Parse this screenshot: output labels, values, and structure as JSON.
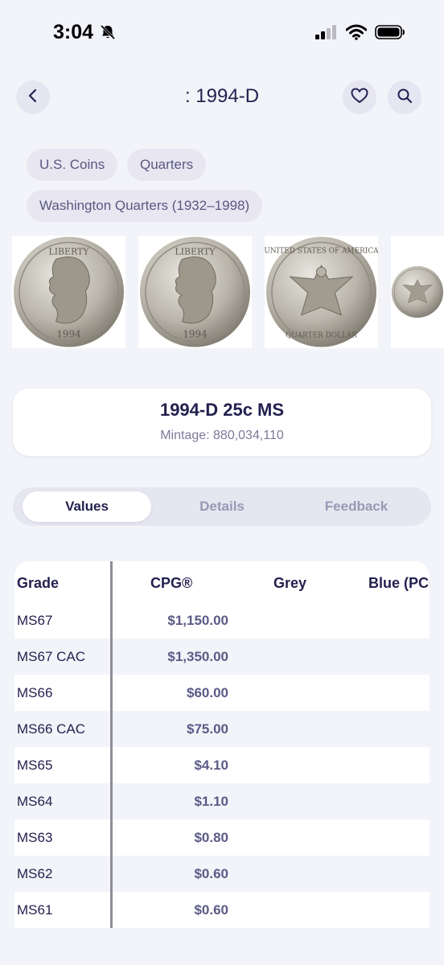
{
  "status_bar": {
    "time": "3:04"
  },
  "header": {
    "title": ": 1994-D"
  },
  "breadcrumbs": [
    "U.S. Coins",
    "Quarters",
    "Washington Quarters (1932–1998)"
  ],
  "coin_images": [
    "obverse",
    "obverse",
    "reverse",
    "reverse"
  ],
  "coin": {
    "name": "1994-D 25c MS",
    "mintage_label": "Mintage:",
    "mintage_value": "880,034,110"
  },
  "tabs": [
    {
      "label": "Values",
      "active": true
    },
    {
      "label": "Details",
      "active": false
    },
    {
      "label": "Feedback",
      "active": false
    }
  ],
  "table": {
    "headers": [
      "Grade",
      "CPG®",
      "Grey",
      "Blue (PCG"
    ],
    "rows": [
      {
        "grade": "MS67",
        "cpg": "$1,150.00"
      },
      {
        "grade": "MS67 CAC",
        "cpg": "$1,350.00"
      },
      {
        "grade": "MS66",
        "cpg": "$60.00"
      },
      {
        "grade": "MS66 CAC",
        "cpg": "$75.00"
      },
      {
        "grade": "MS65",
        "cpg": "$4.10"
      },
      {
        "grade": "MS64",
        "cpg": "$1.10"
      },
      {
        "grade": "MS63",
        "cpg": "$0.80"
      },
      {
        "grade": "MS62",
        "cpg": "$0.60"
      },
      {
        "grade": "MS61",
        "cpg": "$0.60"
      }
    ]
  },
  "colors": {
    "accent": "#24214f",
    "background": "#f3f4f9",
    "chip": "#e7e6f1"
  },
  "icons": [
    "back-arrow-icon",
    "heart-icon",
    "search-icon",
    "bell-slash-icon",
    "cellular-icon",
    "wifi-icon",
    "battery-icon"
  ]
}
